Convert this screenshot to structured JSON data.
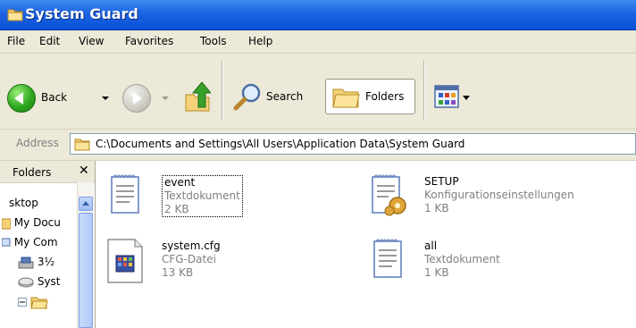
{
  "window": {
    "title": "System Guard"
  },
  "menubar": {
    "items": [
      "File",
      "Edit",
      "View",
      "Favorites",
      "Tools",
      "Help"
    ]
  },
  "toolbar": {
    "back_label": "Back",
    "search_label": "Search",
    "folders_label": "Folders"
  },
  "address": {
    "label": "Address",
    "path": "C:\\Documents and Settings\\All Users\\Application Data\\System Guard"
  },
  "folders_pane": {
    "title": "Folders",
    "close": "✕",
    "items": [
      "sktop",
      "My Docu",
      "My Com",
      "3½",
      "Syst",
      ""
    ]
  },
  "files": [
    {
      "name": "event",
      "type": "Textdokument",
      "size": "2 KB",
      "icon": "text-file-icon",
      "selected": true
    },
    {
      "name": "SETUP",
      "type": "Konfigurationseinstellungen",
      "size": "1 KB",
      "icon": "config-file-icon"
    },
    {
      "name": "system.cfg",
      "type": "CFG-Datei",
      "size": "13 KB",
      "icon": "cfg-file-icon"
    },
    {
      "name": "all",
      "type": "Textdokument",
      "size": "1 KB",
      "icon": "text-file-icon"
    }
  ],
  "colors": {
    "titlebar": "#0a52d6",
    "chrome": "#ece9d8",
    "accent": "#316ac5"
  }
}
